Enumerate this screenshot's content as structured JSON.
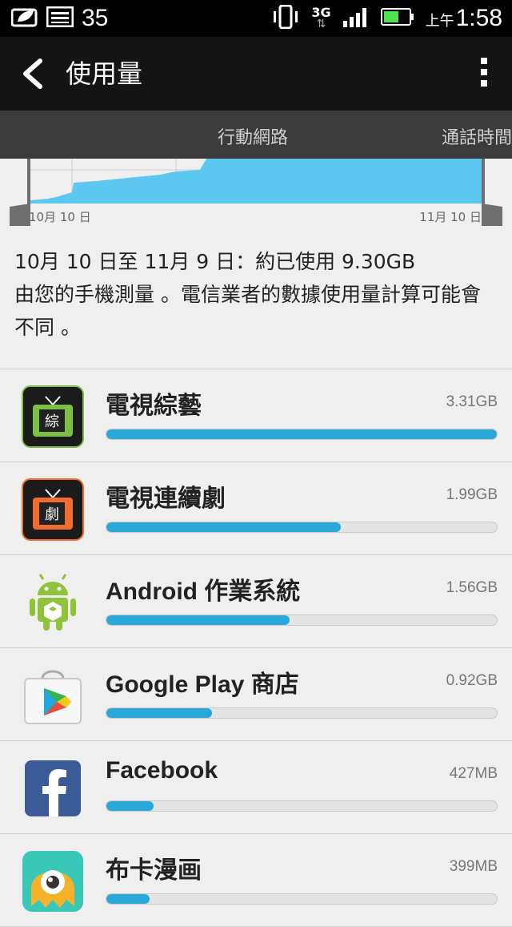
{
  "status_bar": {
    "left_number": "35",
    "network": "3G",
    "ampm": "上午",
    "time": "1:58",
    "icons": [
      "leaf-icon",
      "image-icon",
      "vibrate-icon",
      "3g-data-icon",
      "signal-icon",
      "battery-icon"
    ]
  },
  "app_bar": {
    "title": "使用量"
  },
  "tabs": [
    {
      "label": "行動網路"
    },
    {
      "label": "通話時間"
    }
  ],
  "graph": {
    "start_label": "10月 10 日",
    "end_label": "11月 10 日",
    "fill_color": "#5cc7f0"
  },
  "summary": {
    "line1": "10月 10 日至 11月 9 日：約已使用 9.30GB",
    "line2": "由您的手機測量 。電信業者的數據使用量計算可能會不同 。"
  },
  "apps": [
    {
      "name": "電視綜藝",
      "size": "3.31GB",
      "fraction": 1.0,
      "icon": "tv-variety-icon"
    },
    {
      "name": "電視連續劇",
      "size": "1.99GB",
      "fraction": 0.6,
      "icon": "tv-drama-icon"
    },
    {
      "name": "Android 作業系統",
      "size": "1.56GB",
      "fraction": 0.47,
      "icon": "android-icon"
    },
    {
      "name": "Google Play 商店",
      "size": "0.92GB",
      "fraction": 0.27,
      "icon": "google-play-icon"
    },
    {
      "name": "Facebook",
      "size": "427MB",
      "fraction": 0.12,
      "icon": "facebook-icon"
    },
    {
      "name": "布卡漫画",
      "size": "399MB",
      "fraction": 0.11,
      "icon": "buka-comic-icon"
    }
  ]
}
